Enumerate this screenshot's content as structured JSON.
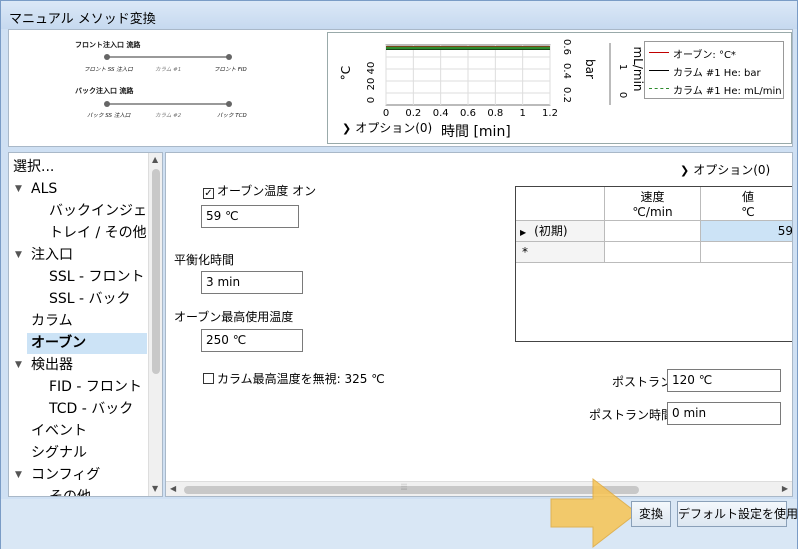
{
  "window": {
    "title": "マニュアル メソッド変換"
  },
  "flow_diagram": {
    "front_title": "フロント注入口 流路",
    "front_left": "フロント SS 注入口",
    "front_mid": "カラム #1",
    "front_right": "フロント FID",
    "back_title": "バック注入口 流路",
    "back_left": "バック SS 注入口",
    "back_mid": "カラム #2",
    "back_right": "バック TCD"
  },
  "chart_data": {
    "type": "line",
    "xlabel": "時間 [min]",
    "x_ticks": [
      "0",
      "0.2",
      "0.4",
      "0.6",
      "0.8",
      "1",
      "1.2"
    ],
    "xlim": [
      0,
      1.2
    ],
    "ylabel_left": "°C",
    "y_ticks_left": [
      "0",
      "20",
      "40"
    ],
    "ylabel_mid": "bar",
    "y_ticks_mid": [
      "0.2",
      "0.4",
      "0.6"
    ],
    "ylabel_right": "mL/min",
    "y_ticks_right": [
      "0",
      "1"
    ],
    "grid": true,
    "legend_position": "top-right",
    "series": [
      {
        "name": "オーブン: °C*",
        "color": "#c00000",
        "x": [
          0,
          1.2
        ],
        "y": [
          59,
          59
        ]
      },
      {
        "name": "カラム #1 He: bar",
        "color": "#000000",
        "x": [
          0,
          1.2
        ],
        "y": [
          0.6,
          0.6
        ]
      },
      {
        "name": "カラム #1 He: mL/min",
        "color": "#2e8b2e",
        "x": [
          0,
          1.2
        ],
        "y": [
          1.6,
          1.6
        ]
      }
    ],
    "options_label": "オプション(0)"
  },
  "tree": {
    "header": "選択...",
    "items": [
      {
        "label": "ALS",
        "expanded": true
      },
      {
        "label": "バックインジェクタ"
      },
      {
        "label": "トレイ / その他"
      },
      {
        "label": "注入口",
        "expanded": true
      },
      {
        "label": "SSL - フロント"
      },
      {
        "label": "SSL - バック"
      },
      {
        "label": "カラム"
      },
      {
        "label": "オーブン",
        "selected": true
      },
      {
        "label": "検出器",
        "expanded": true
      },
      {
        "label": "FID - フロント"
      },
      {
        "label": "TCD - バック"
      },
      {
        "label": "イベント"
      },
      {
        "label": "シグナル"
      },
      {
        "label": "コンフィグ",
        "expanded": true
      },
      {
        "label": "その他"
      }
    ]
  },
  "oven": {
    "options_label": "オプション(0)",
    "oven_temp_check_label": "オーブン温度 オン",
    "oven_temp_checked": true,
    "oven_temp_value": "59 ℃",
    "equil_label": "平衡化時間",
    "equil_value": "3 min",
    "max_temp_label": "オーブン最高使用温度",
    "max_temp_value": "250 ℃",
    "ignore_max_label": "カラム最高温度を無視: 325 ℃",
    "ignore_max_checked": false,
    "post_run_label": "ポストラン:",
    "post_run_value": "120 ℃",
    "post_run_time_label": "ポストラン時間:",
    "post_run_time_value": "0 min"
  },
  "ramp_table": {
    "columns": [
      "速度\n℃/min",
      "値\n℃"
    ],
    "rows": [
      {
        "marker": "▶",
        "label": "(初期)",
        "rate": "",
        "value": "59"
      },
      {
        "marker": "*",
        "label": "",
        "rate": "",
        "value": ""
      }
    ]
  },
  "buttons": {
    "convert": "変換",
    "use_defaults": "デフォルト設定を使用"
  }
}
